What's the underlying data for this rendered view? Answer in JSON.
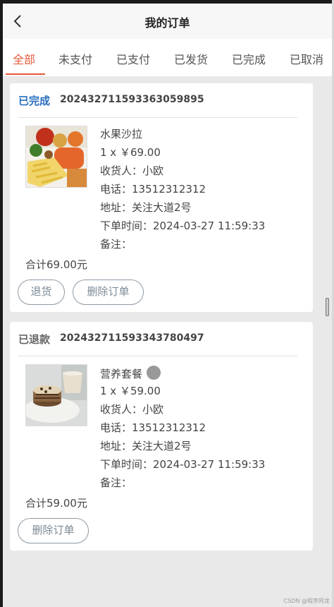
{
  "header": {
    "title": "我的订单"
  },
  "tabs": [
    "全部",
    "未支付",
    "已支付",
    "已发货",
    "已完成",
    "已取消"
  ],
  "active_tab": "全部",
  "colors": {
    "accent": "#e5593a",
    "status_done": "#2a6fbf"
  },
  "labels": {
    "receiver": "收货人：",
    "phone": "电话：",
    "address": "地址：",
    "order_time": "下单时间：",
    "note": "备注："
  },
  "orders": [
    {
      "status": "已完成",
      "order_no": "20243271159336305989​5",
      "product_name": "水果沙拉",
      "image_icon": "salad-image",
      "qty_price": "1 x ￥69.00",
      "receiver": "小欧",
      "phone": "13512312312",
      "address": "关注大道2号",
      "order_time": "2024-03-27 11:59:33",
      "note": "",
      "total": "合计69.00元",
      "buttons": [
        "退货",
        "删除订单"
      ]
    },
    {
      "status": "已退款",
      "order_no": "20243271159334378049​7",
      "product_name": "营养套餐",
      "image_icon": "pancake-image",
      "qty_price": "1 x ￥59.00",
      "receiver": "小欧",
      "phone": "13512312312",
      "address": "关注大道2号",
      "order_time": "2024-03-27 11:59:33",
      "note": "",
      "total": "合计59.00元",
      "buttons": [
        "删除订单"
      ]
    }
  ],
  "watermark": "CSDN @程序阿龙"
}
